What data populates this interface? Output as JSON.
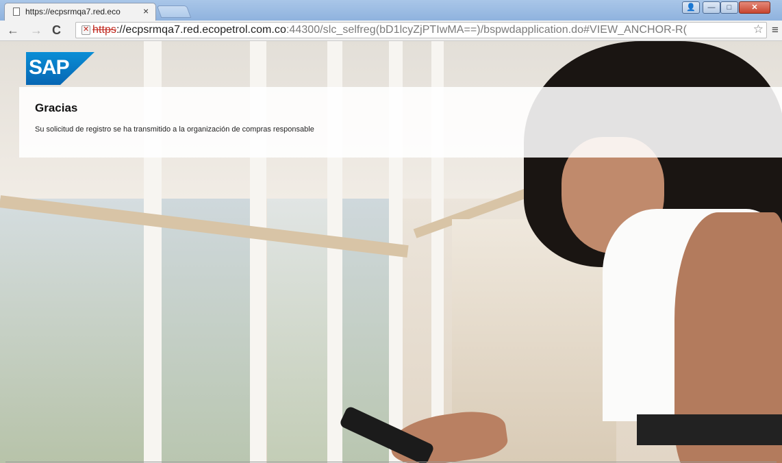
{
  "browser": {
    "tab_title": "https://ecpsrmqa7.red.eco",
    "tab_close": "×",
    "url_scheme": "https",
    "url_host": "://ecpsrmqa7.red.ecopetrol.com.co",
    "url_rest": ":44300/slc_selfreg(bD1lcyZjPTIwMA==)/bspwdapplication.do#VIEW_ANCHOR-R(",
    "window_buttons": {
      "user": "👤",
      "minimize": "—",
      "maximize": "□",
      "close": "✕"
    },
    "nav": {
      "back": "←",
      "forward": "→",
      "reload": "C",
      "star": "☆",
      "menu": "≡"
    }
  },
  "page": {
    "logo_text": "SAP",
    "panel_title": "Gracias",
    "panel_message": "Su solicitud de registro se ha transmitido a la organización de compras responsable"
  },
  "colors": {
    "sap_blue": "#0a8ed6",
    "insecure_red": "#c0271d"
  }
}
